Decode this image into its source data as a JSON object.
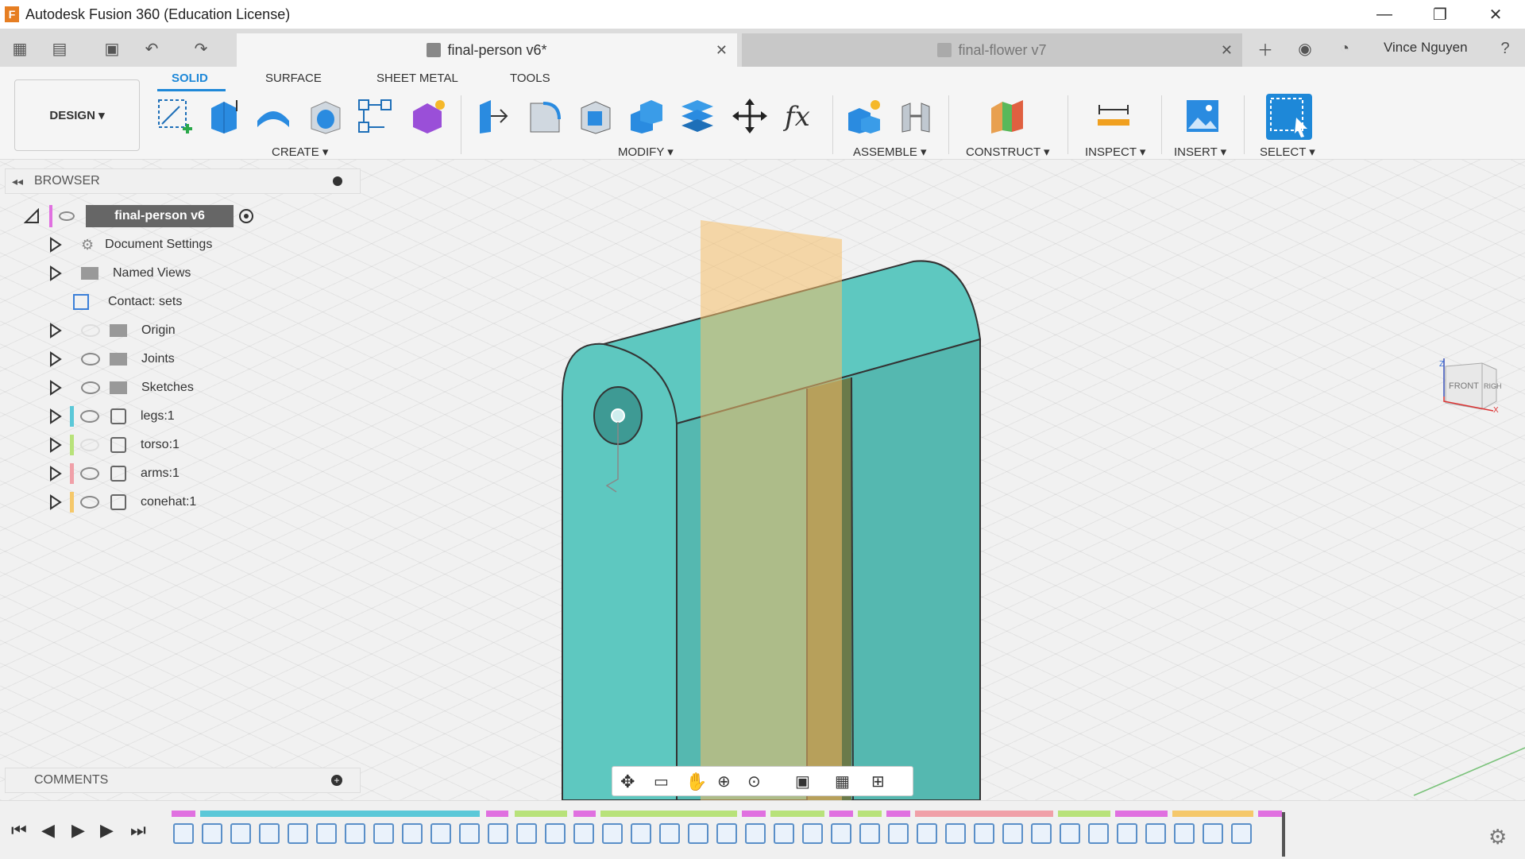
{
  "app": {
    "title": "Autodesk Fusion 360 (Education License)",
    "logo": "F"
  },
  "window_controls": {
    "minimize": "—",
    "restore": "❐",
    "close": "✕"
  },
  "tabs": [
    {
      "label": "final-person v6*",
      "active": true
    },
    {
      "label": "final-flower v7",
      "active": false
    }
  ],
  "user": {
    "name": "Vince Nguyen"
  },
  "ribbon": {
    "tabs": [
      "SOLID",
      "SURFACE",
      "SHEET METAL",
      "TOOLS"
    ],
    "workspace": "DESIGN ▾",
    "groups": {
      "create": "CREATE ▾",
      "modify": "MODIFY ▾",
      "assemble": "ASSEMBLE ▾",
      "construct": "CONSTRUCT ▾",
      "inspect": "INSPECT ▾",
      "insert": "INSERT ▾",
      "select": "SELECT ▾"
    }
  },
  "browser": {
    "title": "BROWSER",
    "root": "final-person v6",
    "items": [
      {
        "label": "Document Settings"
      },
      {
        "label": "Named Views"
      },
      {
        "label": "Contact: sets"
      },
      {
        "label": "Origin"
      },
      {
        "label": "Joints"
      },
      {
        "label": "Sketches"
      },
      {
        "label": "legs:1",
        "color": "#5bc8d8"
      },
      {
        "label": "torso:1",
        "color": "#b8e27a"
      },
      {
        "label": "arms:1",
        "color": "#f0a0a8"
      },
      {
        "label": "conehat:1",
        "color": "#f5c86a"
      }
    ]
  },
  "comments": {
    "label": "COMMENTS"
  },
  "viewcube": {
    "front": "FRONT",
    "right": "RIGHT",
    "z": "Z",
    "x": "X"
  },
  "colors": {
    "accent": "#1e88d8",
    "model": "#5ec8c0",
    "plane": "#f5c06a"
  }
}
